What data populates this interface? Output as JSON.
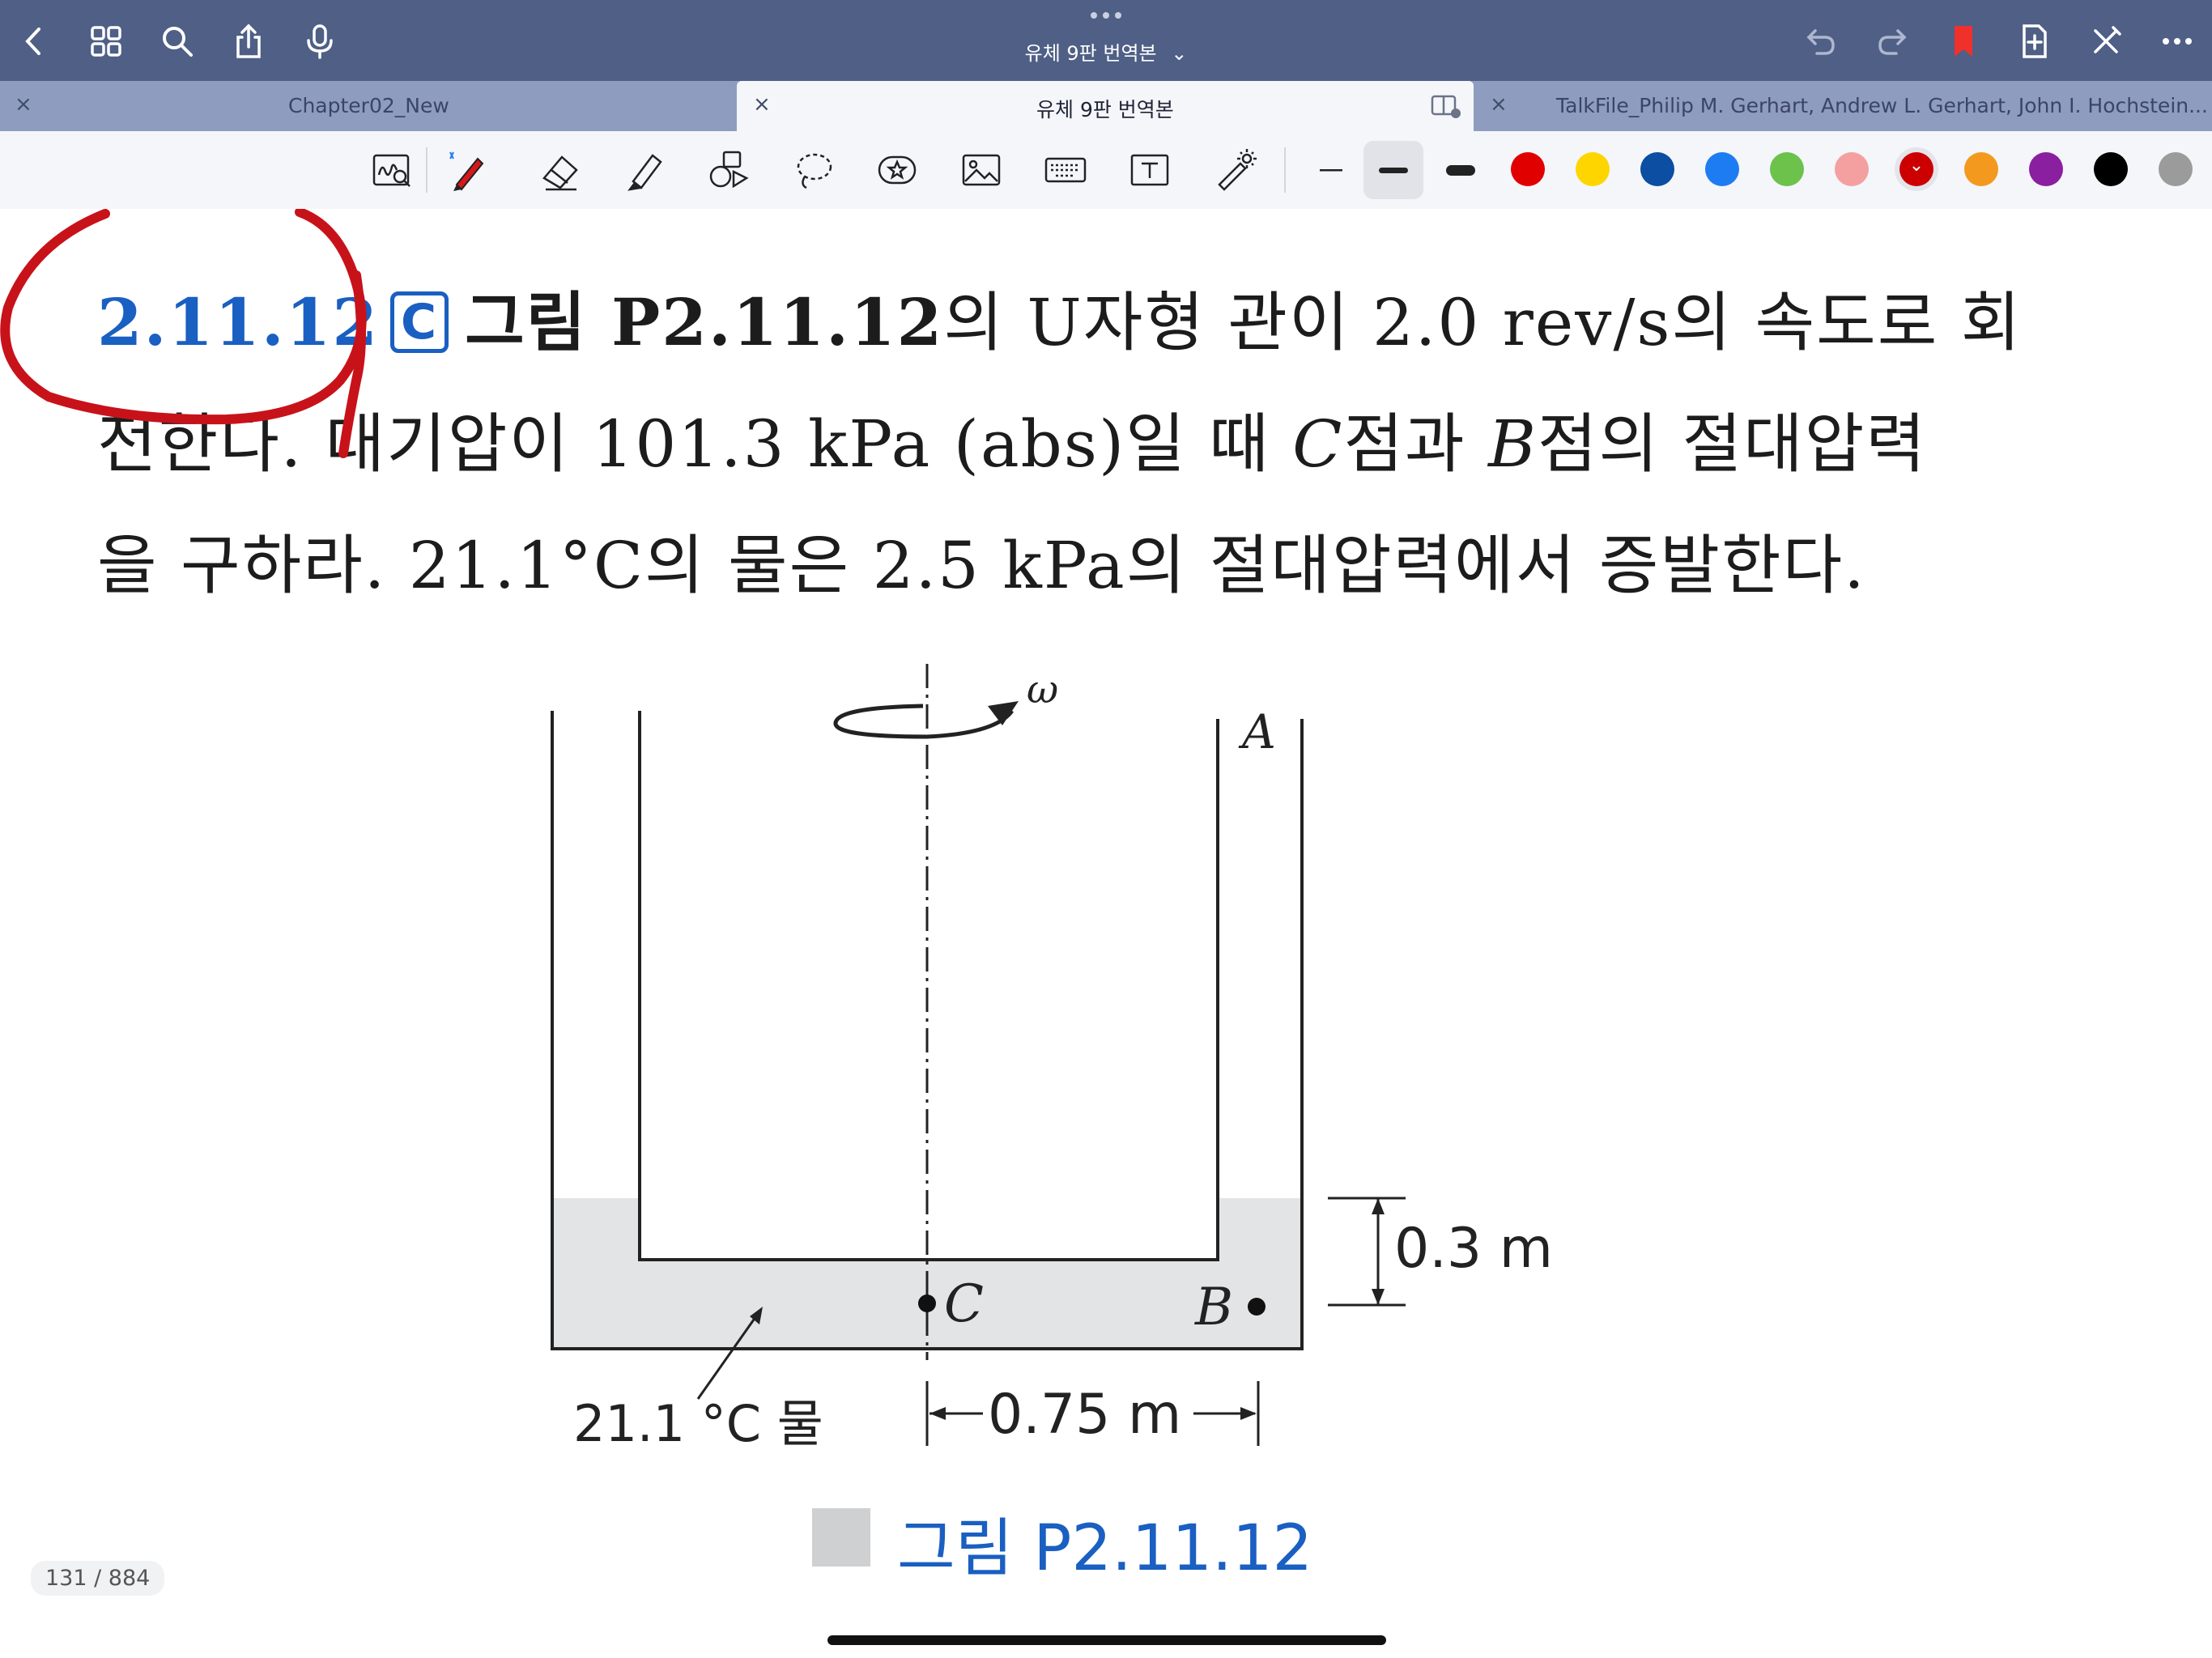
{
  "nav": {
    "title": "유체 9판 번역본",
    "title_chevron": "⌄"
  },
  "tabs": [
    {
      "label": "Chapter02_New",
      "close": "×"
    },
    {
      "label": "유체 9판 번역본",
      "close": "×"
    },
    {
      "label": "TalkFile_Philip M. Gerhart, Andrew L. Gerhart, John I. Hochstein...",
      "close": "×"
    }
  ],
  "toolbar": {
    "pen_colors": [
      "#e00000",
      "#ffd500",
      "#0b4ea2",
      "#1e7cf2",
      "#6cc24a",
      "#f5a0a0",
      "#cc0000",
      "#f39a1e",
      "#8a1fa0",
      "#000000",
      "#9b9b9b"
    ],
    "selected_color": "#cc0000",
    "selected_color_marker": "⌄"
  },
  "problem": {
    "number": "2.11.12",
    "badge": "C",
    "line1_bold": "그림 P2.11.12",
    "line1_rest": "의 U자형 관이 2.0 rev/s의 속도로 회",
    "line2_a": "전한다. 대기압이 101.3 kPa (abs)일 때 ",
    "line2_c": "C",
    "line2_b": "점과 ",
    "line2_bpt": "B",
    "line2_end": "점의 절대압력",
    "line3": "을 구하라. 21.1°C의 물은 2.5 kPa의 절대압력에서 증발한다."
  },
  "figure": {
    "omega": "ω",
    "label_a": "A",
    "label_b": "B",
    "label_c": "C",
    "height_dim": "0.3 m",
    "width_dim": "0.75 m",
    "water_label": "21.1 °C 물",
    "caption": "그림 P2.11.12"
  },
  "page_indicator": "131 / 884"
}
